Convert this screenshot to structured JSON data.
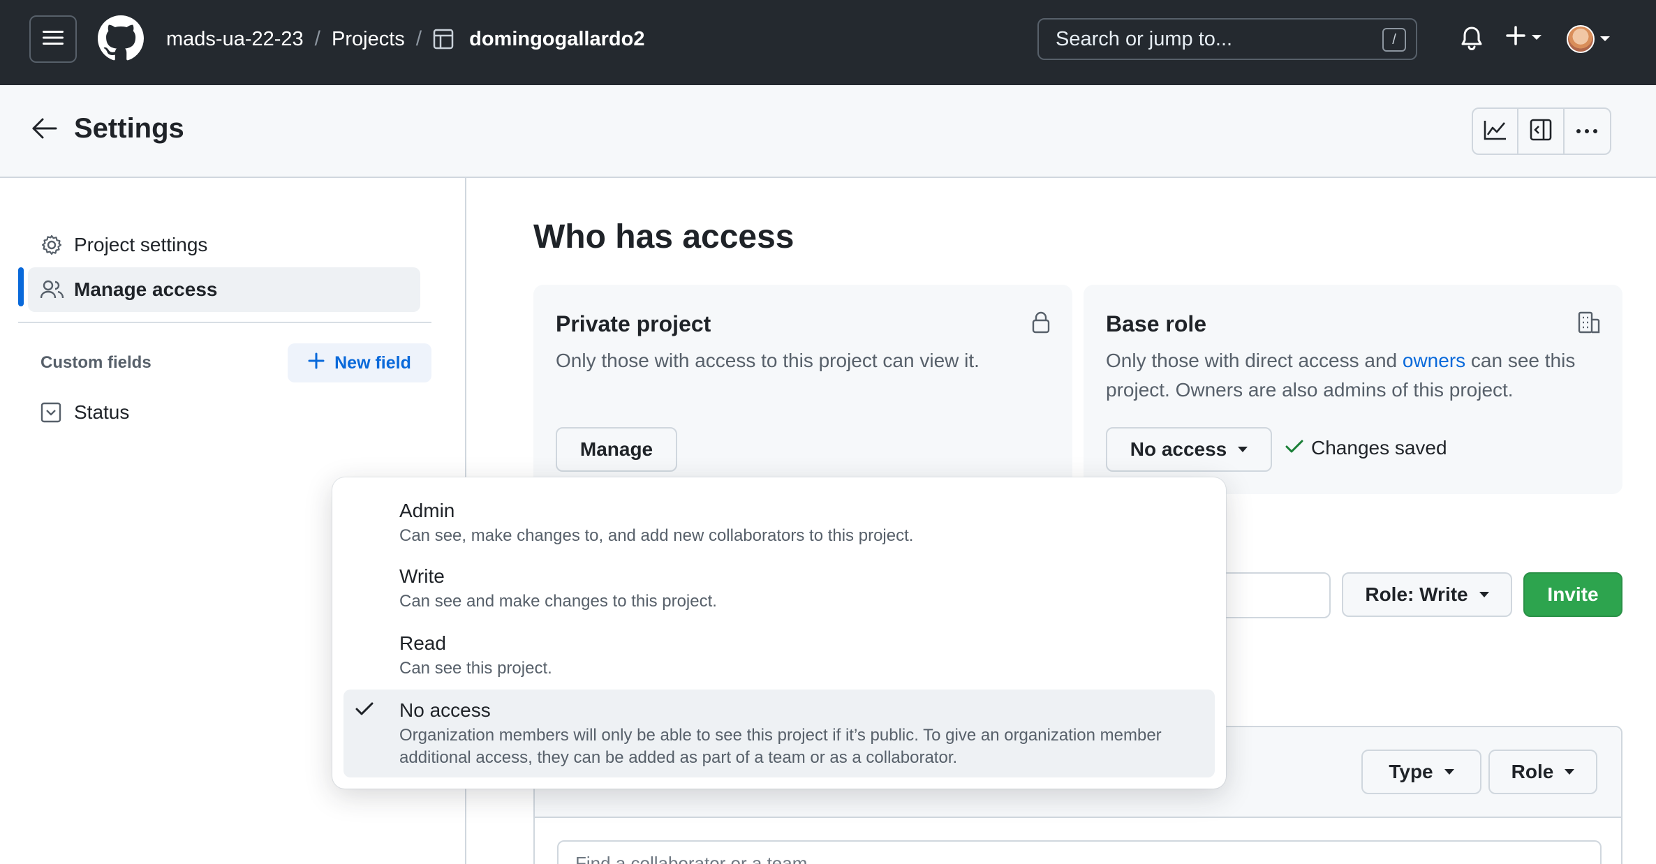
{
  "topbar": {
    "org": "mads-ua-22-23",
    "projects": "Projects",
    "project_name": "domingogallardo2",
    "search_placeholder": "Search or jump to...",
    "search_shortcut": "/"
  },
  "header": {
    "title": "Settings"
  },
  "sidebar": {
    "items": [
      {
        "label": "Project settings",
        "icon": "gear-icon"
      },
      {
        "label": "Manage access",
        "icon": "people-icon",
        "active": true
      }
    ],
    "custom_fields_label": "Custom fields",
    "new_field_label": "New field",
    "fields": [
      {
        "label": "Status",
        "icon": "single-select-icon"
      }
    ]
  },
  "main": {
    "title": "Who has access",
    "private_card": {
      "title": "Private project",
      "description": "Only those with access to this project can view it.",
      "button": "Manage"
    },
    "base_role_card": {
      "title": "Base role",
      "description_before": "Only those with direct access and ",
      "description_link": "owners",
      "description_after": " can see this project. Owners are also admins of this project.",
      "select_value": "No access",
      "saved_text": "Changes saved"
    },
    "invite": {
      "role_button": "Role: Write",
      "invite_button": "Invite"
    },
    "collaborators": {
      "type_filter": "Type",
      "role_filter": "Role",
      "find_placeholder": "Find a collaborator or a team"
    }
  },
  "dropdown": {
    "options": [
      {
        "title": "Admin",
        "description": "Can see, make changes to, and add new collaborators to this project.",
        "selected": false
      },
      {
        "title": "Write",
        "description": "Can see and make changes to this project.",
        "selected": false
      },
      {
        "title": "Read",
        "description": "Can see this project.",
        "selected": false
      },
      {
        "title": "No access",
        "description": "Organization members will only be able to see this project if it’s public. To give an organization member additional access, they can be added as part of a team or as a collaborator.",
        "selected": true
      }
    ]
  },
  "colors": {
    "topbar_bg": "#24292f",
    "accent": "#0969da",
    "invite_green": "#2da44e"
  }
}
